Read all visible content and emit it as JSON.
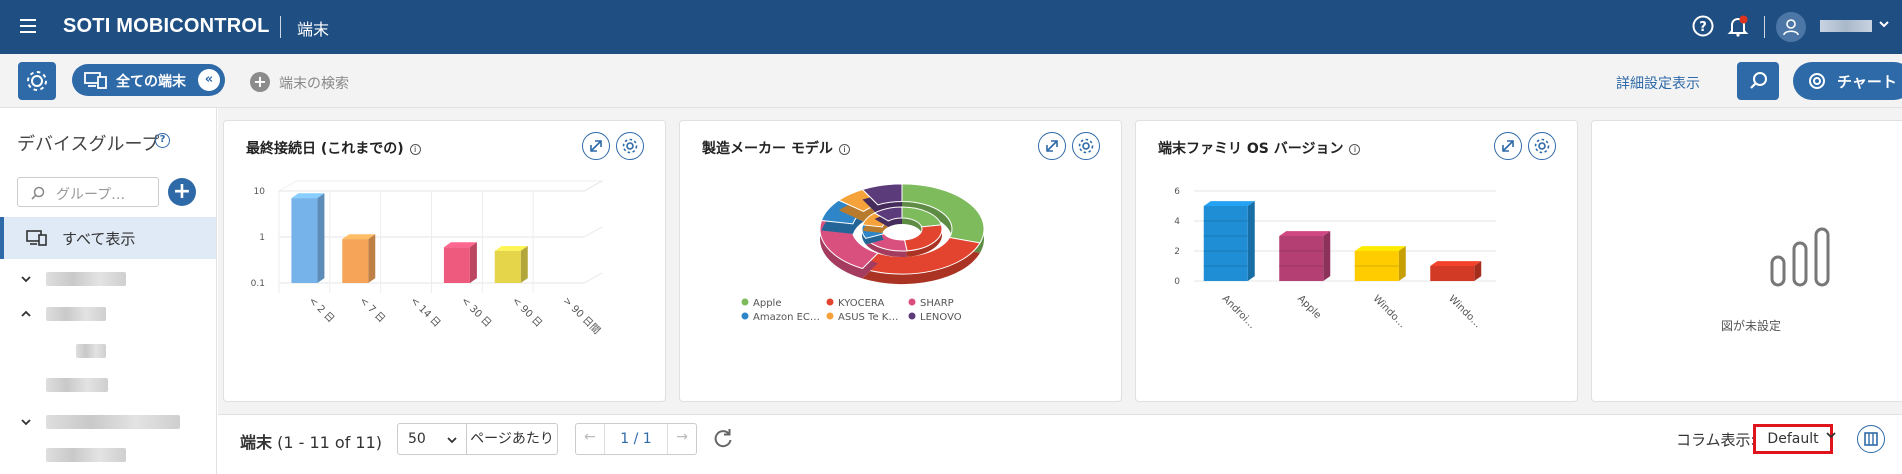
{
  "topbar": {
    "brand": "SOTI MOBICONTROL",
    "section": "端末",
    "help_icon": "help-icon",
    "alert_icon": "bell-alert-icon",
    "user_icon": "user-icon"
  },
  "filterbar": {
    "all_devices_label": "全ての端末",
    "collapse_label": "«",
    "search_placeholder": "端末の検索",
    "advanced_link": "詳細設定表示",
    "chart_button": "チャート"
  },
  "sidebar": {
    "title": "デバイスグループ",
    "help": "?",
    "search_placeholder": "グループ…",
    "show_all": "すべて表示"
  },
  "widgets": [
    {
      "title": "最終接続日 (これまでの)",
      "chart_data": {
        "type": "bar",
        "title": "最終接続日 (これまでの)",
        "scale": "log",
        "y_ticks": [
          "10",
          "1",
          "0.1"
        ],
        "categories": [
          "< 2 日",
          "< 7 日",
          "< 14 日",
          "< 30 日",
          "< 90 日",
          "> 90 日間"
        ],
        "values": [
          7,
          0.9,
          null,
          0.6,
          0.5,
          null
        ],
        "colors": [
          "#76b3ea",
          "#f5a458",
          "#999999",
          "#ee5a7e",
          "#e5d54a",
          "#999999"
        ]
      }
    },
    {
      "title": "製造メーカー モデル",
      "chart_data": {
        "type": "pie",
        "title": "製造メーカー モデル",
        "legend": [
          {
            "name": "Apple",
            "color": "#7dbb5c"
          },
          {
            "name": "KYOCERA",
            "color": "#e2442f"
          },
          {
            "name": "SHARP",
            "color": "#d9507e"
          },
          {
            "name": "Amazon EC…",
            "color": "#2e86c8"
          },
          {
            "name": "ASUS Te K…",
            "color": "#f5a23a"
          },
          {
            "name": "LENOVO",
            "color": "#5c3b7a"
          }
        ],
        "outer_values": [
          30,
          28,
          20,
          8,
          6,
          8
        ],
        "inner_values": [
          22,
          26,
          20,
          10,
          10,
          12
        ]
      }
    },
    {
      "title": "端末ファミリ OS バージョン",
      "chart_data": {
        "type": "bar",
        "title": "端末ファミリ OS バージョン",
        "ylim": [
          0,
          6
        ],
        "y_ticks": [
          "6",
          "4",
          "2",
          "0"
        ],
        "categories": [
          "Androi…",
          "Apple",
          "Windo…",
          "Windo…"
        ],
        "values": [
          5,
          3,
          2,
          1
        ],
        "colors": [
          "#1f8ed4",
          "#b43f72",
          "#ffcc00",
          "#d33a26"
        ]
      }
    },
    {
      "title": "",
      "empty_label": "図が未設定"
    }
  ],
  "bottombar": {
    "title": "端末",
    "range": "(1 - 11 of 11)",
    "per_page": "50",
    "per_page_label": "ページあたり",
    "page": "1 / 1",
    "column_label": "コラム表示:",
    "column_value": "Default"
  }
}
